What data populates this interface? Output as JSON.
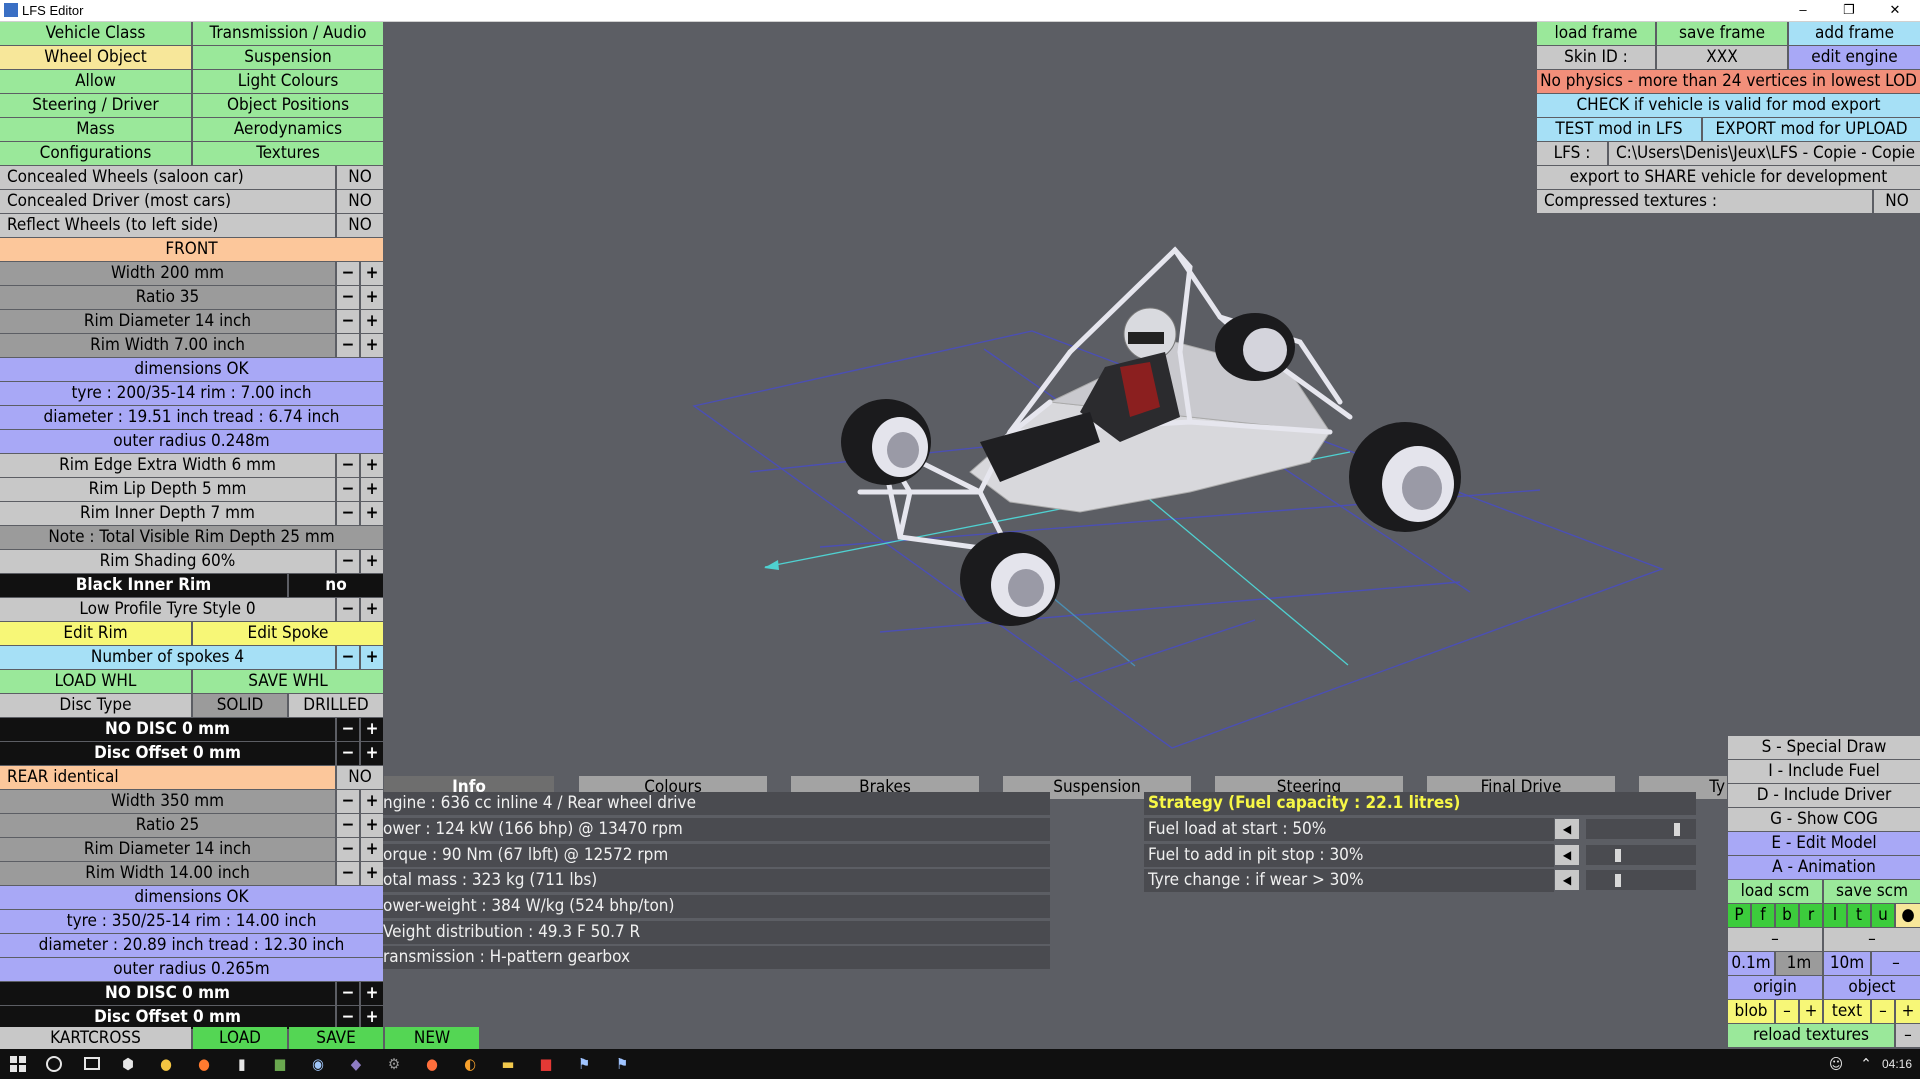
{
  "window": {
    "title": "LFS Editor",
    "controls": {
      "minimize": "–",
      "maximize": "❐",
      "close": "✕"
    }
  },
  "left_panel": {
    "menu_rows": [
      [
        "Vehicle Class",
        "Transmission / Audio"
      ],
      [
        "Wheel Object",
        "Suspension"
      ],
      [
        "Allow",
        "Light Colours"
      ],
      [
        "Steering / Driver",
        "Object Positions"
      ],
      [
        "Mass",
        "Aerodynamics"
      ],
      [
        "Configurations",
        "Textures"
      ]
    ],
    "active_item": "Wheel Object",
    "concealed_wheels": {
      "label": "Concealed Wheels (saloon car)",
      "value": "NO"
    },
    "concealed_driver": {
      "label": "Concealed Driver (most cars)",
      "value": "NO"
    },
    "reflect_wheels": {
      "label": "Reflect Wheels (to left side)",
      "value": "NO"
    },
    "front_header": "FRONT",
    "front": {
      "width": "Width 200 mm",
      "ratio": "Ratio 35",
      "rim_diameter": "Rim Diameter 14 inch",
      "rim_width": "Rim Width 7.00 inch",
      "dimensions_ok": "dimensions OK",
      "tyre": "tyre : 200/35-14   rim : 7.00 inch",
      "diameter": "diameter : 19.51 inch    tread : 6.74 inch",
      "outer_radius": "outer radius 0.248m"
    },
    "rim_edge_extra_width": "Rim Edge Extra Width 6 mm",
    "rim_lip_depth": "Rim Lip Depth 5 mm",
    "rim_inner_depth": "Rim Inner Depth 7 mm",
    "note": "Note : Total Visible Rim Depth 25 mm",
    "rim_shading": "Rim Shading 60%",
    "black_inner_rim": {
      "label": "Black Inner Rim",
      "value": "no"
    },
    "low_profile": "Low Profile Tyre Style 0",
    "edit_rim": "Edit Rim",
    "edit_spoke": "Edit Spoke",
    "spokes": "Number of spokes 4",
    "load_whl": "LOAD WHL",
    "save_whl": "SAVE WHL",
    "disc_type": {
      "label": "Disc Type",
      "solid": "SOLID",
      "drilled": "DRILLED"
    },
    "front_no_disc": "NO DISC 0 mm",
    "front_disc_offset": "Disc Offset 0 mm",
    "rear_identical": {
      "label": "REAR identical",
      "value": "NO"
    },
    "rear": {
      "width": "Width 350 mm",
      "ratio": "Ratio 25",
      "rim_diameter": "Rim Diameter 14 inch",
      "rim_width": "Rim Width 14.00 inch",
      "dimensions_ok": "dimensions OK",
      "tyre": "tyre : 350/25-14   rim : 14.00 inch",
      "diameter": "diameter : 20.89 inch    tread : 12.30 inch",
      "outer_radius": "outer radius 0.265m"
    },
    "rear_no_disc": "NO DISC 0 mm",
    "rear_disc_offset": "Disc Offset 0 mm",
    "minus": "−",
    "plus": "+"
  },
  "bottom_bar": {
    "name": "KARTCROSS",
    "load": "LOAD",
    "save": "SAVE",
    "new": "NEW"
  },
  "tabs": [
    {
      "label": "Info",
      "active": true
    },
    {
      "label": "Colours"
    },
    {
      "label": "Brakes"
    },
    {
      "label": "Suspension"
    },
    {
      "label": "Steering"
    },
    {
      "label": "Final Drive"
    },
    {
      "label": "Ty"
    }
  ],
  "info_lines": [
    "ngine : 636 cc inline 4 / Rear wheel drive",
    "ower : 124 kW (166 bhp) @ 13470 rpm",
    "orque : 90 Nm (67 lbft) @ 12572 rpm",
    "otal mass : 323 kg (711 lbs)",
    "ower-weight : 384 W/kg (524 bhp/ton)",
    "Veight distribution : 49.3 F  50.7 R",
    "ransmission : H-pattern gearbox"
  ],
  "strategy": {
    "title": "Strategy (Fuel capacity : 22.1 litres)",
    "rows": [
      {
        "label": "Fuel load at start : 50%",
        "level": 0.85
      },
      {
        "label": "Fuel to add in pit stop : 30%",
        "level": 0.28
      },
      {
        "label": "Tyre change : if wear > 30%",
        "level": 0.28
      }
    ],
    "arrow": "◀"
  },
  "top_right": {
    "load_frame": "load frame",
    "save_frame": "save frame",
    "add_frame": "add frame",
    "skin_id_label": "Skin ID :",
    "skin_id_value": "XXX",
    "edit_engine": "edit engine",
    "no_physics": "No physics - more than 24 vertices in lowest LOD",
    "check_valid": "CHECK if vehicle is valid for mod export",
    "test_mod": "TEST mod in LFS",
    "export_mod": "EXPORT mod for UPLOAD",
    "lfs_label": "LFS :",
    "lfs_path": "C:\\Users\\Denis\\Jeux\\LFS - Copie - Copie",
    "export_share": "export to SHARE vehicle for development",
    "compressed_label": "Compressed textures :",
    "compressed_value": "NO"
  },
  "bottom_right": {
    "special_draw": "S - Special Draw",
    "include_fuel": "I - Include Fuel",
    "include_driver": "D - Include Driver",
    "show_cog": "G - Show COG",
    "edit_model": "E - Edit Model",
    "animation": "A - Animation",
    "load_scm": "load scm",
    "save_scm": "save scm",
    "toggles": [
      "P",
      "f",
      "b",
      "r",
      "l",
      "t",
      "u",
      "●"
    ],
    "dash1": "–",
    "dash2": "–",
    "scale_01": "0.1m",
    "scale_1": "1m",
    "scale_10": "10m",
    "scale_minus": "–",
    "origin": "origin",
    "object": "object",
    "blob": "blob",
    "text": "text",
    "minus": "–",
    "plus": "+",
    "reload_textures": "reload textures",
    "reload_minus": "–"
  },
  "taskbar": {
    "time": "04:16",
    "icons": [
      "windows-icon",
      "search-icon",
      "taskview-icon",
      "cube-icon",
      "chrome-icon",
      "firefox-icon",
      "notepad-icon",
      "minecraft-icon",
      "steam-icon",
      "teams-icon",
      "settings-icon",
      "origin-icon",
      "blender-icon",
      "explorer-icon",
      "filezilla-icon",
      "lfs-icon",
      "lfs-editor-icon"
    ],
    "tray": [
      "people-icon",
      "chevron-up-icon",
      "keyboard-icon"
    ]
  },
  "colors": {
    "green": "#9ae89a",
    "yellow": "#f7e79a",
    "grey": "#c8c8c8",
    "dark_grey": "#9b9b9b",
    "blue": "#a8a8f6",
    "orange": "#fcc79b",
    "light_blue": "#a6e0f6",
    "red": "#f28f7a",
    "background": "#5c5e64"
  }
}
